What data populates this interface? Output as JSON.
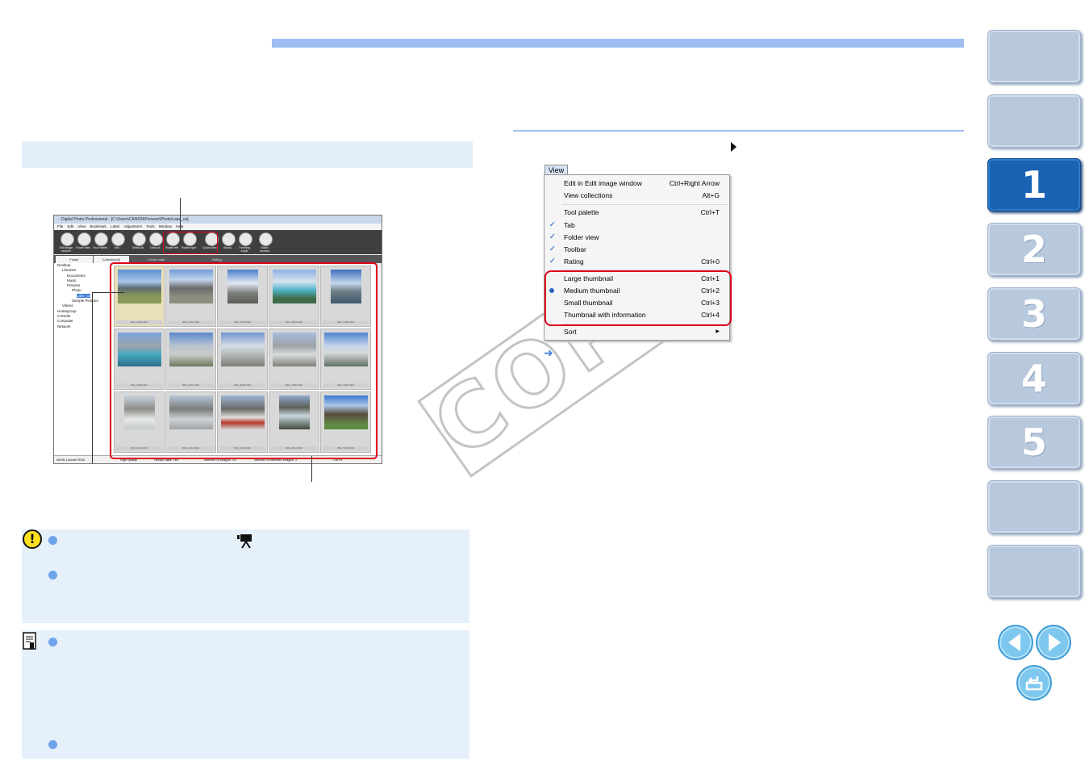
{
  "watermark": "COPY",
  "view_menu": {
    "tab_label": "View",
    "items": [
      {
        "label": "Edit in Edit image window",
        "shortcut": "Ctrl+Right Arrow",
        "checked": false
      },
      {
        "label": "View collections",
        "shortcut": "Alt+G",
        "checked": false
      },
      {
        "label": "Tool palette",
        "shortcut": "Ctrl+T",
        "checked": false
      },
      {
        "label": "Tab",
        "shortcut": "",
        "checked": true
      },
      {
        "label": "Folder view",
        "shortcut": "",
        "checked": true
      },
      {
        "label": "Toolbar",
        "shortcut": "",
        "checked": true
      },
      {
        "label": "Rating",
        "shortcut": "Ctrl+0",
        "checked": true
      },
      {
        "label": "Large thumbnail",
        "shortcut": "Ctrl+1",
        "checked": false
      },
      {
        "label": "Medium thumbnail",
        "shortcut": "Ctrl+2",
        "selected": true
      },
      {
        "label": "Small thumbnail",
        "shortcut": "Ctrl+3",
        "checked": false
      },
      {
        "label": "Thumbnail with information",
        "shortcut": "Ctrl+4",
        "checked": false
      },
      {
        "label": "Sort",
        "shortcut": "",
        "submenu": true
      }
    ]
  },
  "nav": {
    "chapters": [
      "1",
      "2",
      "3",
      "4",
      "5"
    ],
    "active_chapter": "1"
  },
  "screenshot": {
    "title": "Digital Photo Professional - [C:\\Users\\CANON\\Pictures\\Photo\\Lake_ca]",
    "menu": [
      "File",
      "Edit",
      "View",
      "Bookmark",
      "Label",
      "Adjustment",
      "Tools",
      "Window",
      "Help"
    ],
    "toolbar": [
      "Edit image window",
      "Folder view",
      "Tool Palette",
      "Info",
      "Select all",
      "Clear all",
      "Rotate left",
      "Rotate right",
      "Quick check",
      "Stamp",
      "Trimming Angle",
      "Batch process"
    ],
    "tabs": [
      "Folder",
      "Collection(0)"
    ],
    "check_label": "Check mark",
    "rating_label": "Rating",
    "tree": [
      "Desktop",
      "Libraries",
      "Documents",
      "Music",
      "Pictures",
      "Photo",
      "Lake_ca",
      "Sample Pictures",
      "Videos",
      "Homegroup",
      "CANON",
      "Computer",
      "Network"
    ],
    "thumbnails": [
      "IMG_0001.CR2",
      "IMG_0002.CR2",
      "IMG_0003.CR2",
      "IMG_0004.CR2",
      "IMG_0005.CR2",
      "IMG_0006.CR2",
      "IMG_0007.CR2",
      "IMG_0008.CR2",
      "IMG_0009.CR2",
      "IMG_0010.CR2",
      "IMG_0011.CR2",
      "IMG_0012.CR2",
      "IMG_0013.CR2",
      "IMG_0014.CR2",
      "IMG_0015.CR2"
    ],
    "status": [
      "sRGB | Adobe RGB",
      "High quality",
      "Recipe data: Yes",
      "Number of images: 15",
      "Number of selected images: 1",
      "CMYK"
    ]
  },
  "colors": {
    "accent_blue": "#9fbdf0",
    "highlight_red": "#e1001a",
    "nav_active": "#1a63b4",
    "nav_inactive": "#b8c8dd",
    "box_bg": "#e6f0fb"
  }
}
